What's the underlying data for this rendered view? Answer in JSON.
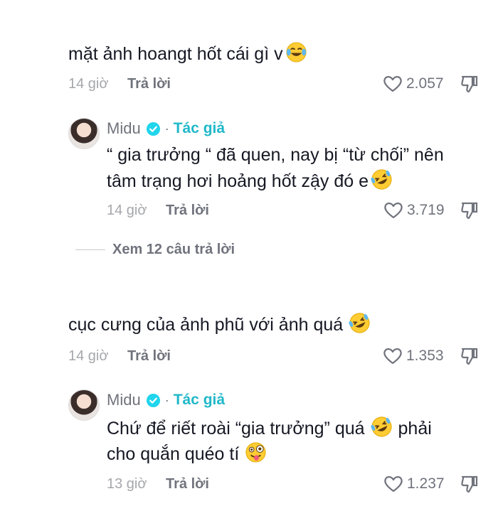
{
  "comments": [
    {
      "text": "mặt ảnh hoangt hốt cái gì v",
      "emoji": "face-with-tears-of-joy",
      "time": "14 giờ",
      "reply_label": "Trả lời",
      "likes": "2.057",
      "reply": {
        "author": "Midu",
        "author_tag": "Tác giả",
        "separator": "·",
        "line1": "“ gia trưởng “ đã quen, nay bị “từ chối” nên",
        "line2": "tâm trạng hơi hoảng hốt zậy đó e",
        "emoji": "rolling-on-floor-laughing",
        "time": "14 giờ",
        "reply_label": "Trả lời",
        "likes": "3.719"
      },
      "view_replies": "Xem 12 câu trả lời"
    },
    {
      "text": "cục cưng của ảnh phũ với ảnh quá",
      "emoji": "rolling-on-floor-laughing",
      "time": "14 giờ",
      "reply_label": "Trả lời",
      "likes": "1.353",
      "reply": {
        "author": "Midu",
        "author_tag": "Tác giả",
        "separator": "·",
        "line1": "Chứ để riết roài “gia trưởng” quá",
        "line1_emoji": "rolling-on-floor-laughing",
        "line1_after": "phải",
        "line2": "cho quắn quéo tí",
        "emoji": "zany-face",
        "time": "13 giờ",
        "reply_label": "Trả lời",
        "likes": "1.237"
      }
    }
  ],
  "colors": {
    "text": "#161823",
    "muted": "#70737c",
    "time": "#a6a7ab",
    "author_tag": "#20b8c9",
    "verified": "#20d5ec"
  },
  "icons": {
    "like": "heart-outline-icon",
    "dislike": "thumbs-down-outline-icon",
    "verified": "verified-badge-icon"
  }
}
